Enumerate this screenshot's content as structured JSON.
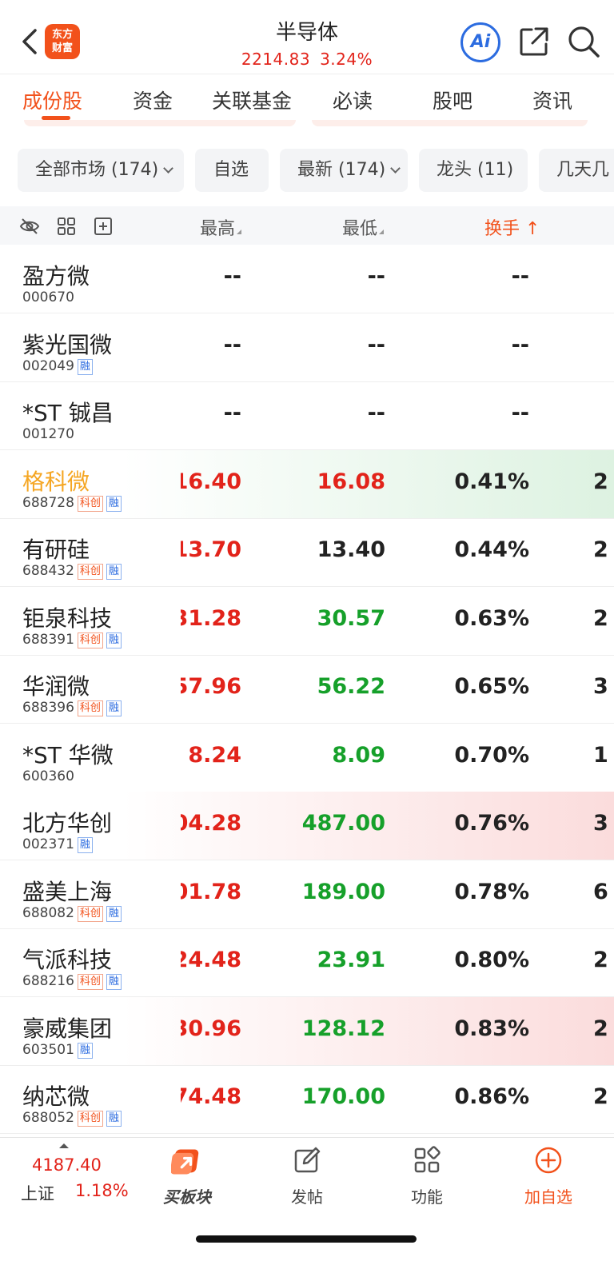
{
  "header": {
    "logo_text": "东方财富",
    "title": "半导体",
    "price": "2214.83",
    "change": "3.24%",
    "ai_label": "Ai"
  },
  "tabs": [
    {
      "label": "成份股",
      "active": true
    },
    {
      "label": "资金",
      "active": false
    },
    {
      "label": "关联基金",
      "active": false
    },
    {
      "label": "必读",
      "active": false
    },
    {
      "label": "股吧",
      "active": false
    },
    {
      "label": "资讯",
      "active": false
    }
  ],
  "filters": [
    {
      "label": "全部市场 (174)",
      "dropdown": true
    },
    {
      "label": "自选",
      "dropdown": false
    },
    {
      "label": "最新 (174)",
      "dropdown": true
    },
    {
      "label": "龙头 (11)",
      "dropdown": false
    },
    {
      "label": "几天几",
      "dropdown": false
    }
  ],
  "columns": {
    "high": "最高",
    "low": "最低",
    "turnover": "换手",
    "turnover_sort": "↑"
  },
  "rows": [
    {
      "name": "盈方微",
      "code": "000670",
      "kc": false,
      "rong": false,
      "high": "--",
      "low": "--",
      "turnover": "--",
      "extra": "",
      "high_color": "dark",
      "low_color": "dark",
      "name_color": "#222222",
      "bg": "none"
    },
    {
      "name": "紫光国微",
      "code": "002049",
      "kc": false,
      "rong": true,
      "high": "--",
      "low": "--",
      "turnover": "--",
      "extra": "",
      "high_color": "dark",
      "low_color": "dark",
      "name_color": "#222222",
      "bg": "none"
    },
    {
      "name": "*ST 铖昌",
      "code": "001270",
      "kc": false,
      "rong": false,
      "high": "--",
      "low": "--",
      "turnover": "--",
      "extra": "",
      "high_color": "dark",
      "low_color": "dark",
      "name_color": "#222222",
      "bg": "none"
    },
    {
      "name": "格科微",
      "code": "688728",
      "kc": true,
      "rong": true,
      "high": "16.40",
      "low": "16.08",
      "turnover": "0.41%",
      "extra": "2",
      "high_color": "red",
      "low_color": "red",
      "name_color": "#f5a623",
      "bg": "green"
    },
    {
      "name": "有研硅",
      "code": "688432",
      "kc": true,
      "rong": true,
      "high": "13.70",
      "low": "13.40",
      "turnover": "0.44%",
      "extra": "2",
      "high_color": "red",
      "low_color": "dark",
      "name_color": "#222222",
      "bg": "none"
    },
    {
      "name": "钜泉科技",
      "code": "688391",
      "kc": true,
      "rong": true,
      "high": "31.28",
      "low": "30.57",
      "turnover": "0.63%",
      "extra": "2",
      "high_color": "red",
      "low_color": "green",
      "name_color": "#222222",
      "bg": "none"
    },
    {
      "name": "华润微",
      "code": "688396",
      "kc": true,
      "rong": true,
      "high": "57.96",
      "low": "56.22",
      "turnover": "0.65%",
      "extra": "3",
      "high_color": "red",
      "low_color": "green",
      "name_color": "#222222",
      "bg": "none"
    },
    {
      "name": "*ST 华微",
      "code": "600360",
      "kc": false,
      "rong": false,
      "high": "8.24",
      "low": "8.09",
      "turnover": "0.70%",
      "extra": "1",
      "high_color": "red",
      "low_color": "green",
      "name_color": "#222222",
      "bg": "none"
    },
    {
      "name": "北方华创",
      "code": "002371",
      "kc": false,
      "rong": true,
      "high": "04.28",
      "low": "487.00",
      "turnover": "0.76%",
      "extra": "3",
      "high_color": "red",
      "low_color": "green",
      "name_color": "#222222",
      "bg": "red"
    },
    {
      "name": "盛美上海",
      "code": "688082",
      "kc": true,
      "rong": true,
      "high": "01.78",
      "low": "189.00",
      "turnover": "0.78%",
      "extra": "6",
      "high_color": "red",
      "low_color": "green",
      "name_color": "#222222",
      "bg": "none"
    },
    {
      "name": "气派科技",
      "code": "688216",
      "kc": true,
      "rong": true,
      "high": "24.48",
      "low": "23.91",
      "turnover": "0.80%",
      "extra": "2",
      "high_color": "red",
      "low_color": "green",
      "name_color": "#222222",
      "bg": "none"
    },
    {
      "name": "豪威集团",
      "code": "603501",
      "kc": false,
      "rong": true,
      "high": "30.96",
      "low": "128.12",
      "turnover": "0.83%",
      "extra": "2",
      "high_color": "red",
      "low_color": "green",
      "name_color": "#222222",
      "bg": "red"
    },
    {
      "name": "纳芯微",
      "code": "688052",
      "kc": true,
      "rong": true,
      "high": "74.48",
      "low": "170.00",
      "turnover": "0.86%",
      "extra": "2",
      "high_color": "red",
      "low_color": "green",
      "name_color": "#222222",
      "bg": "none"
    }
  ],
  "badges": {
    "kc": "科创",
    "rong": "融"
  },
  "bottom": {
    "index_value": "4187.40",
    "index_name": "上证",
    "index_change": "1.18%",
    "nav": [
      {
        "label": "买板块",
        "icon": "buy-sector-icon"
      },
      {
        "label": "发帖",
        "icon": "edit-icon"
      },
      {
        "label": "功能",
        "icon": "grid-icon"
      },
      {
        "label": "加自选",
        "icon": "add-circle-icon"
      }
    ]
  },
  "colors": {
    "accent": "#f2511b",
    "up": "#e2231a",
    "down": "#16a02a",
    "link": "#2c6ce0"
  }
}
